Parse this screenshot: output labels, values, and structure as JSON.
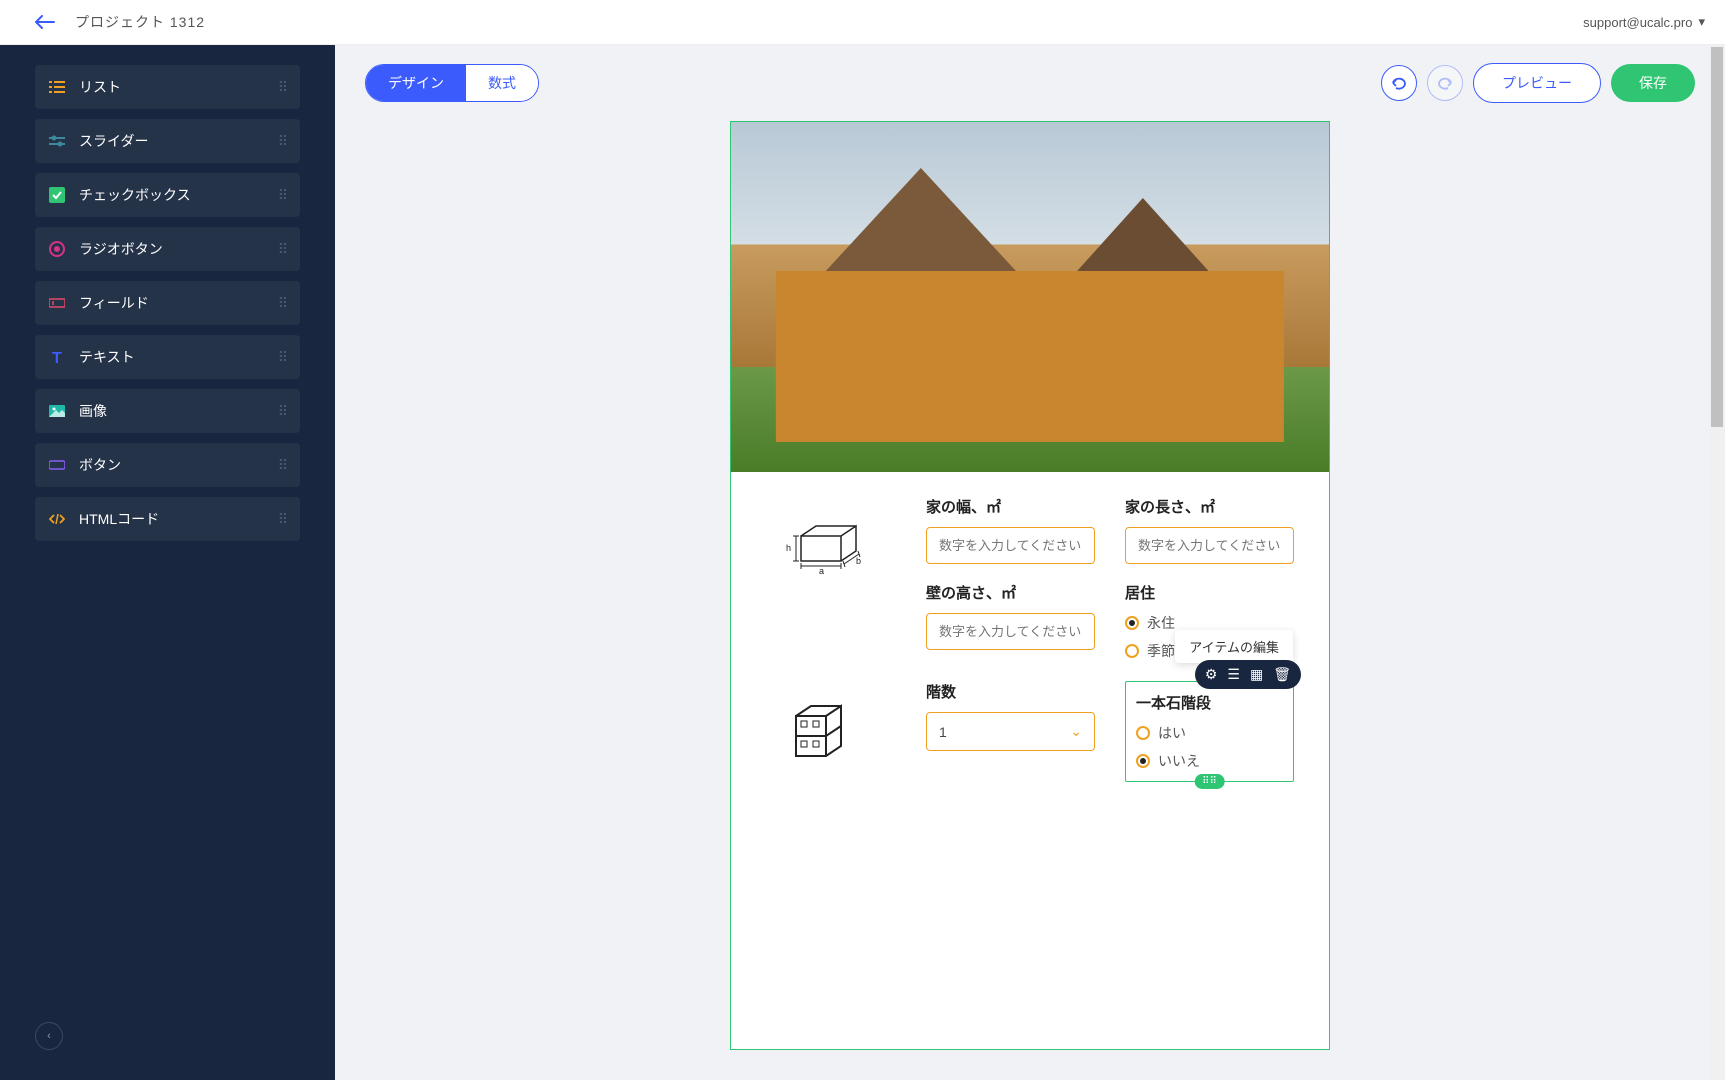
{
  "header": {
    "project_title": "プロジェクト 1312",
    "account": "support@ucalc.pro"
  },
  "sidebar": {
    "items": [
      {
        "label": "リスト",
        "icon": "list",
        "color": "#f0a020"
      },
      {
        "label": "スライダー",
        "icon": "slider",
        "color": "#3b8a9c"
      },
      {
        "label": "チェックボックス",
        "icon": "checkbox",
        "color": "#2fc573"
      },
      {
        "label": "ラジオボタン",
        "icon": "radio",
        "color": "#d63384"
      },
      {
        "label": "フィールド",
        "icon": "field",
        "color": "#e24a68"
      },
      {
        "label": "テキスト",
        "icon": "text",
        "color": "#3b5bfd"
      },
      {
        "label": "画像",
        "icon": "image",
        "color": "#20b8a8"
      },
      {
        "label": "ボタン",
        "icon": "button",
        "color": "#8a5cf6"
      },
      {
        "label": "HTMLコード",
        "icon": "code",
        "color": "#f0a020"
      }
    ]
  },
  "toolbar": {
    "tabs": {
      "design": "デザイン",
      "formula": "数式",
      "active": "design"
    },
    "preview_label": "プレビュー",
    "save_label": "保存"
  },
  "form": {
    "fields": {
      "width": {
        "label": "家の幅、㎡",
        "placeholder": "数字を入力してください"
      },
      "length": {
        "label": "家の長さ、㎡",
        "placeholder": "数字を入力してください"
      },
      "wall_height": {
        "label": "壁の高さ、㎡",
        "placeholder": "数字を入力してください"
      },
      "residence": {
        "label": "居住",
        "options": [
          {
            "label": "永住",
            "checked": true
          },
          {
            "label": "季節限",
            "checked": false
          }
        ]
      },
      "floors": {
        "label": "階数",
        "value": "1"
      },
      "stairs": {
        "label": "一本石階段",
        "options": [
          {
            "label": "はい",
            "checked": false
          },
          {
            "label": "いいえ",
            "checked": true
          }
        ]
      }
    }
  },
  "tooltip": {
    "edit_item": "アイテムの編集"
  }
}
